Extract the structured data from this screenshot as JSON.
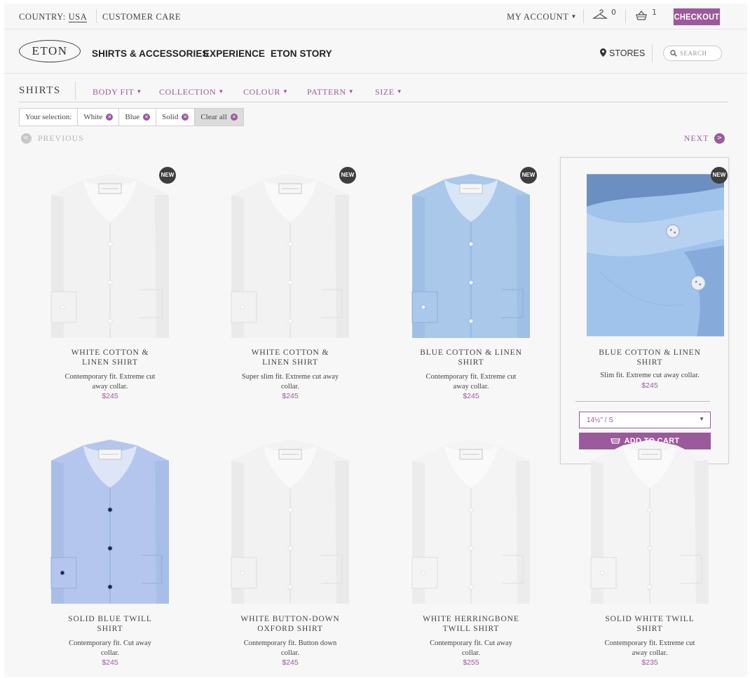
{
  "topbar": {
    "country_label": "COUNTRY:",
    "country_value": "USA",
    "customer_care": "CUSTOMER CARE",
    "my_account": "MY ACCOUNT",
    "wishlist_count": "0",
    "cart_count": "1",
    "checkout": "CHECKOUT"
  },
  "nav": {
    "logo": "ETON",
    "links": [
      "SHIRTS & ACCESSORIES",
      "EXPERIENCE",
      "ETON STORY"
    ],
    "stores": "STORES",
    "search_placeholder": "SEARCH"
  },
  "filters": {
    "category": "SHIRTS",
    "items": [
      "BODY FIT",
      "COLLECTION",
      "COLOUR",
      "PATTERN",
      "SIZE"
    ]
  },
  "selection": {
    "label": "Your selection:",
    "chips": [
      "White",
      "Blue",
      "Solid"
    ],
    "clear": "Clear all"
  },
  "pager": {
    "previous": "PREVIOUS",
    "next": "NEXT"
  },
  "products": [
    {
      "name": "WHITE COTTON & LINEN SHIRT",
      "desc": "Contemporary fit. Extreme cut away collar.",
      "price": "$245",
      "badge": "NEW",
      "color": "#f2f2f2"
    },
    {
      "name": "WHITE COTTON & LINEN SHIRT",
      "desc": "Super slim fit. Extreme cut away collar.",
      "price": "$245",
      "badge": "NEW",
      "color": "#f2f2f2"
    },
    {
      "name": "BLUE COTTON & LINEN SHIRT",
      "desc": "Contemporary fit. Extreme cut away collar.",
      "price": "$245",
      "badge": "NEW",
      "color": "#a9c8ea"
    },
    {
      "name": "BLUE COTTON & LINEN SHIRT",
      "desc": "Slim fit. Extreme cut away collar.",
      "price": "$245",
      "badge": "NEW",
      "color": "#9fc3ea"
    },
    {
      "name": "SOLID BLUE TWILL SHIRT",
      "desc": "Contemporary fit. Cut away collar.",
      "price": "$245",
      "color": "#b5c6ee"
    },
    {
      "name": "WHITE BUTTON-DOWN OXFORD SHIRT",
      "desc": "Contemporary fit. Button down collar.",
      "price": "$245",
      "color": "#f2f2f2"
    },
    {
      "name": "WHITE HERRINGBONE TWILL SHIRT",
      "desc": "Contemporary fit. Cut away collar.",
      "price": "$255",
      "color": "#f4f4f4"
    },
    {
      "name": "SOLID WHITE TWILL SHIRT",
      "desc": "Contemporary fit. Extreme cut away collar.",
      "price": "$235",
      "color": "#f4f4f4"
    }
  ],
  "hover_card": {
    "size_value": "14½\" / S",
    "add_to_cart": "ADD TO CART"
  },
  "colors": {
    "accent": "#9b5a9b",
    "badge": "#3e3e3e"
  }
}
